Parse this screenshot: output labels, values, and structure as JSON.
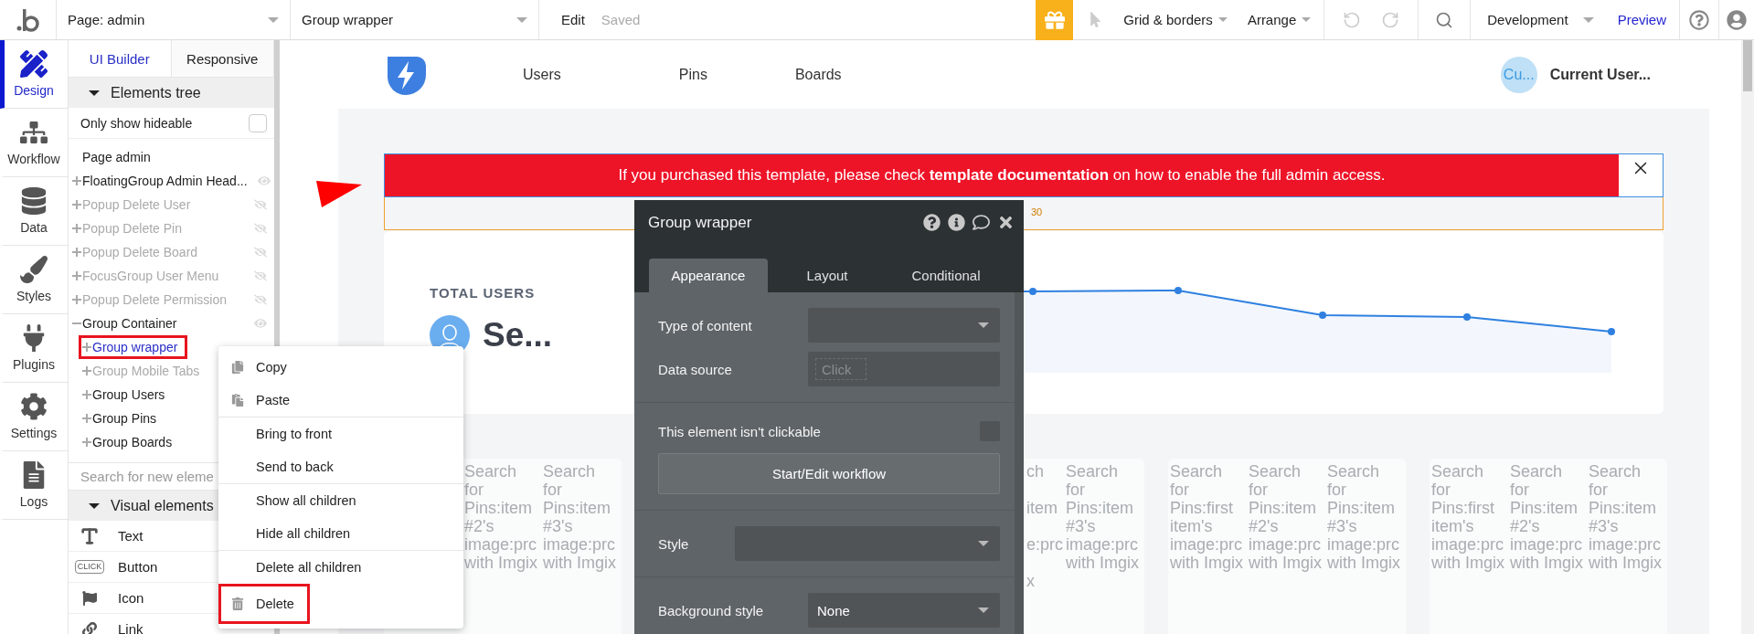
{
  "topbar": {
    "page": "Page: admin",
    "element": "Group wrapper",
    "edit": "Edit",
    "status": "Saved",
    "grid": "Grid & borders",
    "arrange": "Arrange",
    "environment": "Development",
    "preview": "Preview"
  },
  "rail": [
    {
      "label": "Design",
      "selected": true
    },
    {
      "label": "Workflow",
      "selected": false
    },
    {
      "label": "Data",
      "selected": false
    },
    {
      "label": "Styles",
      "selected": false
    },
    {
      "label": "Plugins",
      "selected": false
    },
    {
      "label": "Settings",
      "selected": false
    },
    {
      "label": "Logs",
      "selected": false
    }
  ],
  "panel_tabs": [
    {
      "label": "UI Builder",
      "selected": true
    },
    {
      "label": "Responsive",
      "selected": false
    }
  ],
  "elements_tree": {
    "title": "Elements tree",
    "expanded": true,
    "filter": {
      "label": "Only show hideable",
      "checked": false
    },
    "root": {
      "label": "Page admin",
      "selected": false,
      "hidden": false,
      "marked": false,
      "children": [
        {
          "label": "FloatingGroup Admin Head...",
          "expanded": false,
          "hidden": false,
          "selected": false,
          "marked": false,
          "eye": true
        },
        {
          "label": "Popup Delete User",
          "expanded": false,
          "hidden": true,
          "selected": false,
          "marked": false,
          "eye": true
        },
        {
          "label": "Popup Delete Pin",
          "expanded": false,
          "hidden": true,
          "selected": false,
          "marked": false,
          "eye": true
        },
        {
          "label": "Popup Delete Board",
          "expanded": false,
          "hidden": true,
          "selected": false,
          "marked": false,
          "eye": true
        },
        {
          "label": "FocusGroup User Menu",
          "expanded": false,
          "hidden": true,
          "selected": false,
          "marked": false,
          "eye": true
        },
        {
          "label": "Popup Delete Permission",
          "expanded": false,
          "hidden": true,
          "selected": false,
          "marked": false,
          "eye": true
        },
        {
          "label": "Group Container",
          "expanded": true,
          "hidden": false,
          "selected": false,
          "marked": false,
          "eye": true,
          "children": [
            {
              "label": "Group wrapper",
              "expanded": false,
              "hidden": false,
              "selected": true,
              "marked": true
            },
            {
              "label": "Group Mobile Tabs",
              "expanded": false,
              "hidden": true,
              "selected": false,
              "marked": false
            },
            {
              "label": "Group Users",
              "expanded": false,
              "hidden": false,
              "selected": false,
              "marked": false
            },
            {
              "label": "Group Pins",
              "expanded": false,
              "hidden": false,
              "selected": false,
              "marked": false
            },
            {
              "label": "Group Boards",
              "expanded": false,
              "hidden": false,
              "selected": false,
              "marked": false
            }
          ]
        }
      ]
    }
  },
  "search": {
    "placeholder": "Search for new eleme"
  },
  "visual_elements": {
    "title": "Visual elements",
    "expanded": true,
    "items": [
      {
        "label": "Text"
      },
      {
        "label": "Button",
        "badge": "CLICK"
      },
      {
        "label": "Icon"
      },
      {
        "label": "Link"
      }
    ]
  },
  "context_menu": {
    "sections": [
      [
        {
          "label": "Copy",
          "marked": false
        },
        {
          "label": "Paste",
          "marked": false
        }
      ],
      [
        {
          "label": "Bring to front",
          "marked": false
        },
        {
          "label": "Send to back",
          "marked": false
        }
      ],
      [
        {
          "label": "Show all children",
          "marked": false
        },
        {
          "label": "Hide all children",
          "marked": false
        }
      ],
      [
        {
          "label": "Delete all children",
          "marked": false
        },
        {
          "label": "Delete",
          "marked": true
        }
      ]
    ]
  },
  "app_header": {
    "nav": [
      {
        "label": "Users"
      },
      {
        "label": "Pins"
      },
      {
        "label": "Boards"
      }
    ],
    "avatar": "Cu...",
    "user": "Current User..."
  },
  "banner": {
    "message": "If you purchased this template, please check **template documentation** on how to enable the full admin access.",
    "spacing": "30"
  },
  "stats": {
    "title": "TOTAL USERS",
    "value": "Se..."
  },
  "cards": [
    {
      "columns": [
        {
          "kind": "text",
          "text": "Search for Pins:item #2's image:prc with Imgix"
        },
        {
          "kind": "text",
          "text": "Search for Pins:item #3's image:prc with Imgix"
        }
      ]
    },
    {
      "columns": [
        {
          "kind": "cut",
          "fragments": [
            "ch",
            "item",
            "e:prc",
            "x"
          ]
        },
        {
          "kind": "text",
          "text": "Search for Pins:item #3's image:prc with Imgix"
        }
      ]
    },
    {
      "columns": [
        {
          "kind": "text",
          "text": "Search for Pins:first item's image:prc with Imgix"
        },
        {
          "kind": "text",
          "text": "Search for Pins:item #2's image:prc with Imgix"
        },
        {
          "kind": "text",
          "text": "Search for Pins:item #3's image:prc with Imgix"
        }
      ]
    },
    {
      "columns": [
        {
          "kind": "text",
          "text": "Search for Pins:first item's image:prc with Imgix"
        },
        {
          "kind": "text",
          "text": "Search for Pins:item #2's image:prc with Imgix"
        },
        {
          "kind": "text",
          "text": "Search for Pins:item #3's image:prc with Imgix"
        }
      ]
    }
  ],
  "property_editor": {
    "title": "Group wrapper",
    "tabs": [
      {
        "label": "Appearance",
        "selected": true
      },
      {
        "label": "Layout",
        "selected": false
      },
      {
        "label": "Conditional",
        "selected": false
      }
    ],
    "sections": [
      [
        {
          "kind": "select",
          "label": "Type of content"
        },
        {
          "kind": "input",
          "label": "Data source",
          "placeholder": "Click"
        }
      ],
      [
        {
          "kind": "checkbox",
          "label": "This element isn't clickable",
          "checked": false
        },
        {
          "kind": "button",
          "label": "Start/Edit workflow"
        }
      ],
      [
        {
          "kind": "wide_select",
          "label": "Style"
        }
      ],
      [
        {
          "kind": "select",
          "label": "Background style",
          "value": "None"
        }
      ]
    ]
  }
}
